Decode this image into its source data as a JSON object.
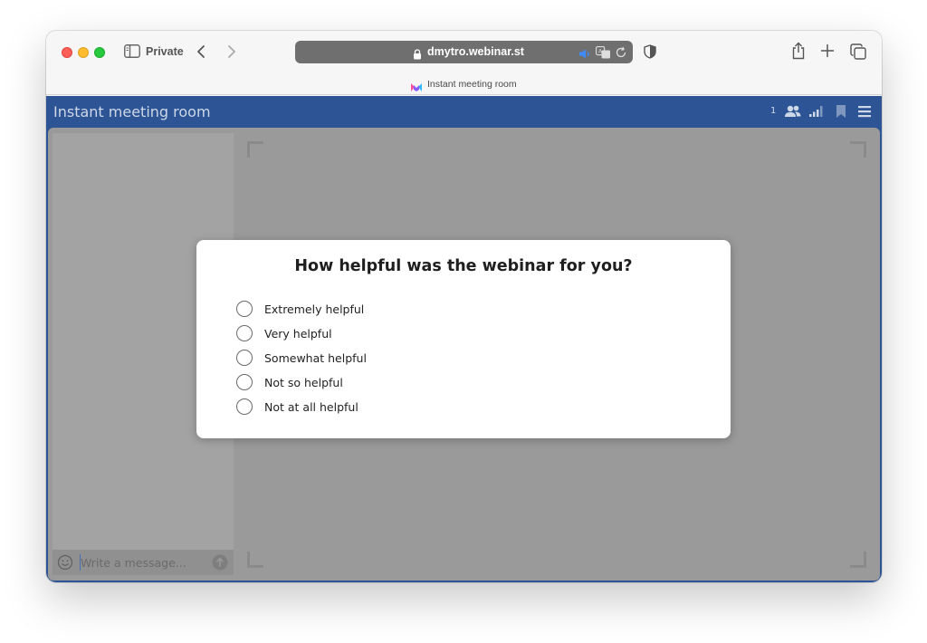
{
  "browser": {
    "private_label": "Private",
    "url": "dmytro.webinar.st",
    "tab_title": "Instant meeting room",
    "icons": [
      "sidebar-toggle-icon",
      "back-icon",
      "forward-icon",
      "lock-icon",
      "audio-icon",
      "translate-icon",
      "reload-icon",
      "shield-icon",
      "share-icon",
      "new-tab-icon",
      "tab-overview-icon"
    ]
  },
  "app": {
    "title": "Instant meeting room",
    "participant_count": "1",
    "header_icons": [
      "people-icon",
      "signal-icon",
      "bookmark-icon",
      "menu-icon"
    ],
    "header_color": "#2d5494"
  },
  "chat": {
    "input_placeholder": "Write a message...",
    "icons": [
      "emoji-icon",
      "send-icon"
    ]
  },
  "poll": {
    "question": "How helpful was the webinar for you?",
    "options": [
      {
        "label": "Extremely helpful",
        "selected": false
      },
      {
        "label": "Very helpful",
        "selected": false
      },
      {
        "label": "Somewhat helpful",
        "selected": false
      },
      {
        "label": "Not so helpful",
        "selected": false
      },
      {
        "label": "Not at all helpful",
        "selected": false
      }
    ]
  }
}
